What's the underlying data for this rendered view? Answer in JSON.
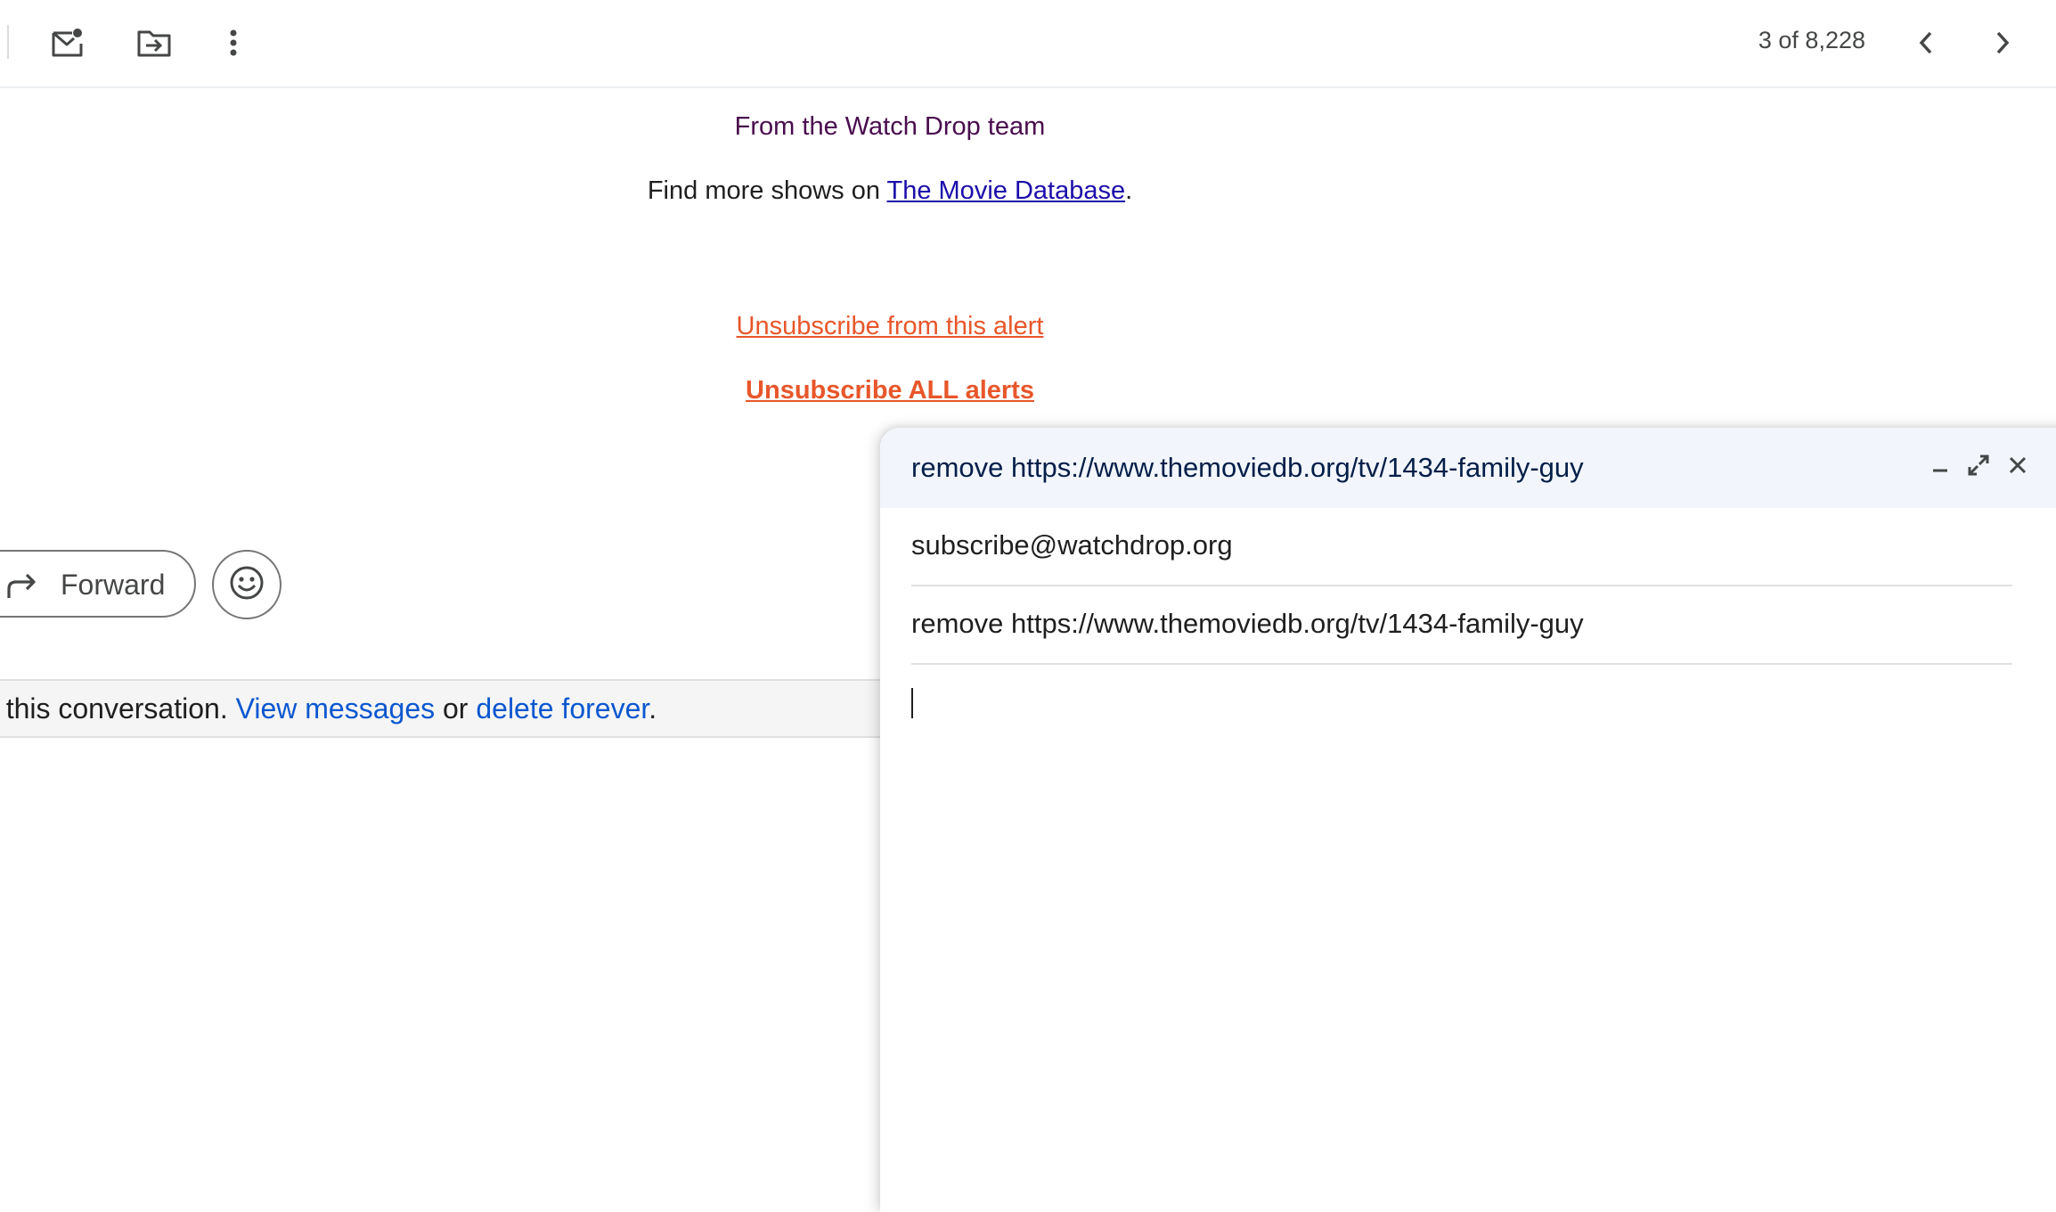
{
  "toolbar": {
    "counter": "3 of 8,228",
    "icons": [
      "mark-unread-icon",
      "move-to-icon",
      "more-vert-icon",
      "chevron-left-icon",
      "chevron-right-icon"
    ]
  },
  "message": {
    "team_line": "From the Watch Drop team",
    "find_more_prefix": "Find more shows on ",
    "find_more_link": "The Movie Database",
    "find_more_suffix": ".",
    "unsubscribe_alert": "Unsubscribe from this alert",
    "unsubscribe_all": "Unsubscribe ALL alerts"
  },
  "actions": {
    "forward_label": "Forward"
  },
  "notice": {
    "prefix": "n this conversation. ",
    "view_messages": "View messages",
    "middle": " or ",
    "delete_forever": "delete forever",
    "suffix": "."
  },
  "compose": {
    "title": "remove https://www.themoviedb.org/tv/1434-family-guy",
    "to": "subscribe@watchdrop.org",
    "subject": "remove https://www.themoviedb.org/tv/1434-family-guy",
    "body": ""
  },
  "colors": {
    "unsubscribe": "#e8562a",
    "link": "#1a0dab",
    "notice_link": "#0b57d0",
    "team_text": "#4a0d4e",
    "compose_header_bg": "#f2f6fc"
  }
}
